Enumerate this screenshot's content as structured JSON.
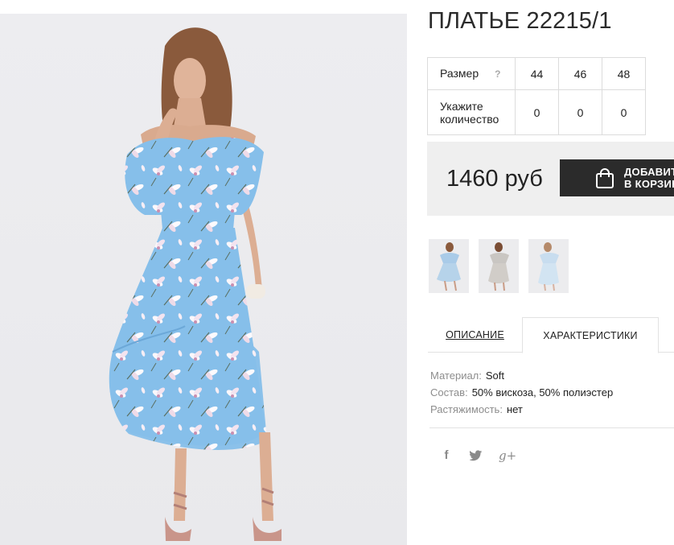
{
  "product": {
    "title": "ПЛАТЬЕ 22215/1",
    "image_alt": "Платье голубое с цветочным принтом"
  },
  "sizes": {
    "label": "Размер",
    "help": "?",
    "values": [
      "44",
      "46",
      "48"
    ],
    "qty_label_line1": "Укажите",
    "qty_label_line2": "количество",
    "quantities": [
      "0",
      "0",
      "0"
    ]
  },
  "price": {
    "amount": "1460 руб",
    "add_to_cart": "ДОБАВИТЬ В КОРЗИНУ"
  },
  "thumbnails": [
    "thumb-1",
    "thumb-2",
    "thumb-3"
  ],
  "tabs": {
    "description": "ОПИСАНИЕ",
    "characteristics": "ХАРАКТЕРИСТИКИ"
  },
  "props": [
    {
      "key": "Материал:",
      "value": "Soft"
    },
    {
      "key": "Состав:",
      "value": "50% вискоза, 50% полиэстер"
    },
    {
      "key": "Растяжимость:",
      "value": "нет"
    }
  ],
  "social": {
    "facebook": "f",
    "twitter": "twitter-icon",
    "google": "g+"
  },
  "colors": {
    "dark_button": "#2b2b2b",
    "price_bg": "#efefef",
    "dress_blue": "#8cc2ec"
  }
}
